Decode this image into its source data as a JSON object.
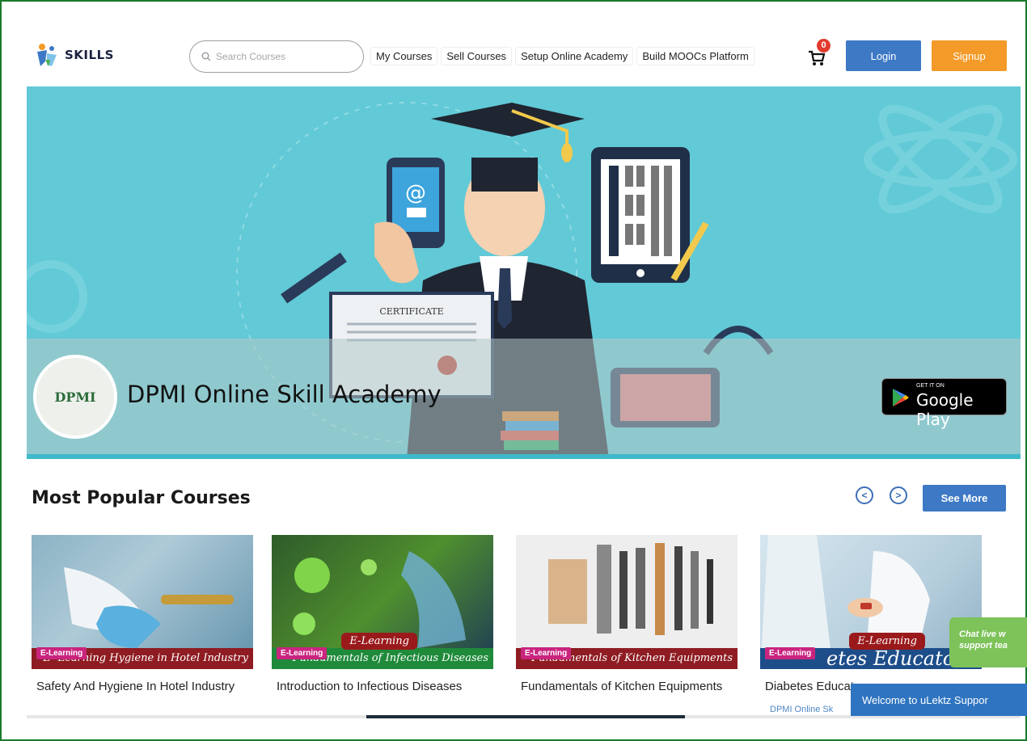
{
  "header": {
    "logo_text": "SKILLS",
    "search_placeholder": "Search Courses",
    "nav": [
      "My Courses",
      "Sell Courses",
      "Setup Online Academy",
      "Build MOOCs Platform"
    ],
    "cart_count": "0",
    "login_label": "Login",
    "signup_label": "Signup"
  },
  "hero": {
    "logo_text": "DPMI",
    "academy_name": "DPMI Online Skill Academy",
    "certificate_text": "CERTIFICATE",
    "store_small": "GET IT ON",
    "store_big": "Google Play"
  },
  "section": {
    "title": "Most Popular Courses",
    "see_more_label": "See More"
  },
  "courses": [
    {
      "title": "Safety And Hygiene In Hotel Industry",
      "badge": "E-Learning",
      "banner": "E- Learning  Hygiene in Hotel Industry",
      "elearn": "",
      "sub": ""
    },
    {
      "title": "Introduction to Infectious Diseases",
      "badge": "E-Learning",
      "banner": "Fundamentals of Infectious Diseases",
      "elearn": "E-Learning",
      "sub": ""
    },
    {
      "title": "Fundamentals of Kitchen Equipments",
      "badge": "E-Learning",
      "banner": "Fundamentals of Kitchen Equipments",
      "elearn": "",
      "sub": ""
    },
    {
      "title": "Diabetes Educator",
      "badge": "E-Learning",
      "banner": "etes Educato",
      "elearn": "E-Learning",
      "sub": "DPMI Online Sk"
    }
  ],
  "chat": {
    "bubble_line1": "Chat live w",
    "bubble_line2": "support tea",
    "bar_text": "Welcome to uLektz Suppor"
  },
  "colors": {
    "frame": "#1a7a2e",
    "primary": "#3d79c5",
    "signup": "#f39a28",
    "hero_bg": "#62c9d6",
    "badge": "#c9257f",
    "chat_green": "#7dc35a"
  }
}
